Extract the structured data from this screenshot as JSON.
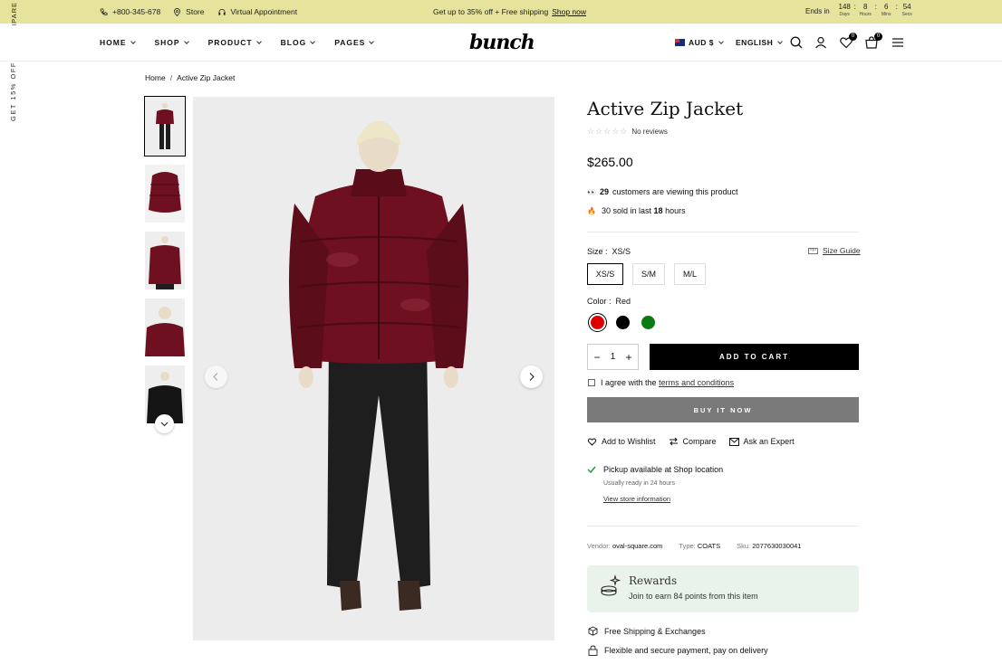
{
  "topbar": {
    "phone": "+800-345-678",
    "store": "Store",
    "appointment": "Virtual Appointment",
    "promo": "Get up to 35% off + Free shipping",
    "shop_now": "Shop now",
    "ends_in": "Ends in",
    "countdown": [
      {
        "value": "148",
        "unit": "Days"
      },
      {
        "value": "8",
        "unit": "Hours"
      },
      {
        "value": "6",
        "unit": "Mins"
      },
      {
        "value": "54",
        "unit": "Secs"
      }
    ],
    "separator": ":"
  },
  "side": {
    "compare": "MPARE",
    "offer": "GET 15% OFF"
  },
  "header": {
    "nav": [
      "HOME",
      "SHOP",
      "PRODUCT",
      "BLOG",
      "PAGES"
    ],
    "logo": "bunch",
    "currency": "AUD $",
    "language": "ENGLISH",
    "wishlist_count": "0",
    "cart_count": "0",
    "icons": [
      "search-icon",
      "account-icon",
      "wishlist-icon",
      "cart-icon",
      "menu-icon"
    ]
  },
  "breadcrumb": {
    "home": "Home",
    "separator": "/",
    "current": "Active Zip Jacket"
  },
  "product": {
    "title": "Active Zip Jacket",
    "reviews": "No reviews",
    "rating": 0,
    "price": "$265.00",
    "viewers_icon": "👀",
    "viewers_count": "29",
    "viewers_text": "customers are viewing this product",
    "sold_icon": "🔥",
    "sold_text": "30 sold in last",
    "sold_hours": "18",
    "sold_suffix": "hours",
    "size_label": "Size :",
    "size_value": "XS/S",
    "size_guide": "Size Guide",
    "sizes": [
      "XS/S",
      "S/M",
      "M/L"
    ],
    "color_label": "Color :",
    "color_value": "Red",
    "colors": [
      "#e00000",
      "#000000",
      "#0a7a14"
    ],
    "quantity": "1",
    "minus": "−",
    "plus": "+",
    "add_to_cart": "ADD TO CART",
    "agree_text": "I agree with the",
    "terms": "terms and conditions",
    "buy_now": "BUY IT NOW",
    "wishlist": "Add to Wishlist",
    "compare": "Compare",
    "ask": "Ask an Expert",
    "pickup": "Pickup available at Shop location",
    "ready": "Usually ready in 24 hours",
    "store_info": "View store information",
    "vendor_label": "Vendor:",
    "vendor": "oval-square.com",
    "type_label": "Type:",
    "type": "COATS",
    "sku_label": "Sku:",
    "sku": "2077630030041",
    "rewards_title": "Rewards",
    "rewards_text": "Join to earn 84 points from this item",
    "shipping": "Free Shipping & Exchanges",
    "payment": "Flexible and secure payment, pay on delivery"
  },
  "colors": {
    "topbar_bg": "#e6e39c",
    "buy_now_bg": "#7a7a7a",
    "rewards_bg": "#eaf2ec",
    "jacket": "#6e1020",
    "pants": "#1e1e1e"
  }
}
